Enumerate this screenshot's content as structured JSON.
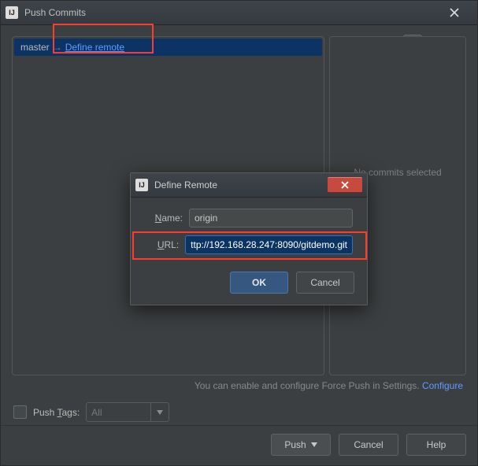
{
  "titlebar": {
    "title": "Push Commits",
    "logo": "IJ"
  },
  "branch_row": {
    "branch": "master",
    "arrow": "→",
    "define_remote": "Define remote"
  },
  "right_panel": {
    "placeholder": "No commits selected"
  },
  "hint": {
    "text": "You can enable and configure Force Push in Settings. ",
    "link": "Configure"
  },
  "tags_row": {
    "label_prefix": "Push ",
    "label_underline": "T",
    "label_suffix": "ags:",
    "combo_value": "All"
  },
  "buttons": {
    "push": "Push",
    "cancel": "Cancel",
    "help": "Help"
  },
  "dialog": {
    "title": "Define Remote",
    "logo": "IJ",
    "name_label_u": "N",
    "name_label_rest": "ame:",
    "name_value": "origin",
    "url_label_u": "U",
    "url_label_rest": "RL:",
    "url_value": "ttp://192.168.28.247:8090/gitdemo.git",
    "ok": "OK",
    "cancel": "Cancel"
  }
}
